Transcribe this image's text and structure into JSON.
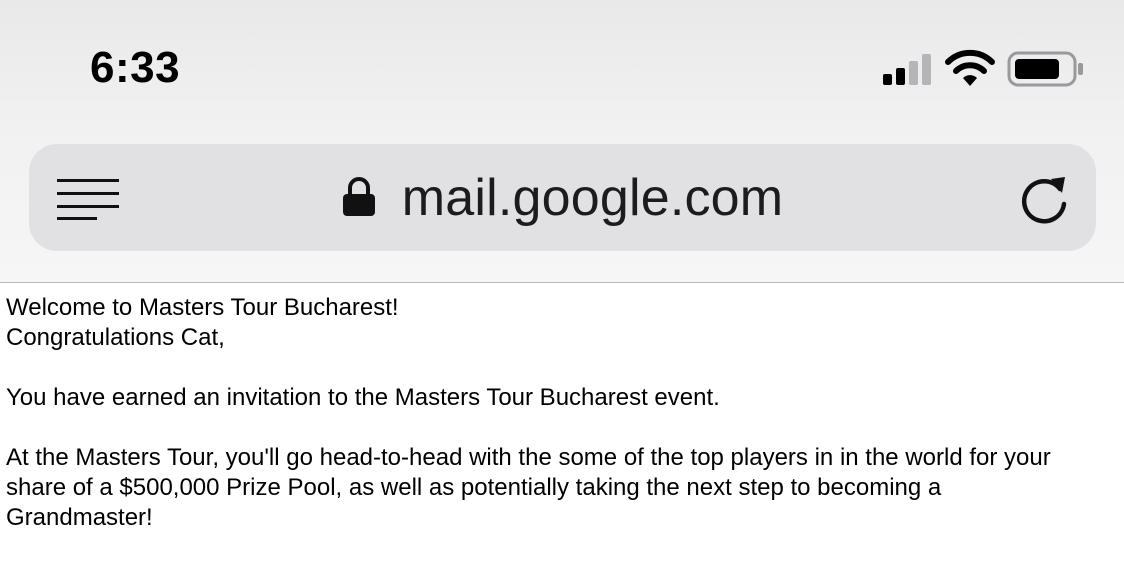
{
  "status_bar": {
    "time": "6:33",
    "icons": [
      "signal-icon",
      "wifi-icon",
      "battery-icon"
    ]
  },
  "browser": {
    "url": "mail.google.com",
    "icons": [
      "menu-icon",
      "lock-icon",
      "reload-icon"
    ]
  },
  "email": {
    "subject": "Welcome to Masters Tour Bucharest!",
    "greeting": "Congratulations Cat,",
    "paragraph1": "You have earned an invitation to the Masters Tour Bucharest event.",
    "paragraph2_line1": "At the Masters Tour, you'll go head-to-head with the some of the top players in in the world for your",
    "paragraph2_line2": "share of a $500,000 Prize Pool, as well as potentially taking the next step to becoming a",
    "paragraph2_line3": "Grandmaster!"
  },
  "colors": {
    "url_bar_bg": "#e1e1e4",
    "chrome_bg": "#efeff0",
    "text": "#000000"
  }
}
